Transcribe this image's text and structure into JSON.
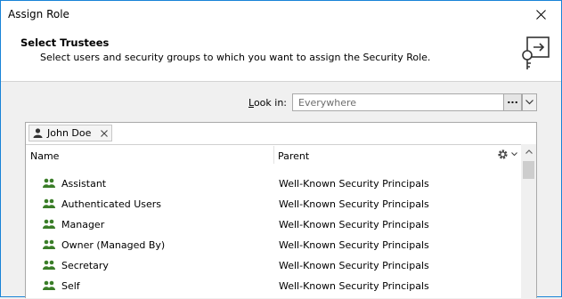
{
  "window": {
    "title": "Assign Role"
  },
  "header": {
    "title": "Select Trustees",
    "subtitle": "Select users and security groups to which you want to assign the Security Role."
  },
  "lookin": {
    "label_access": "L",
    "label_rest": "ook in:",
    "value": "Everywhere",
    "browse_label": "..."
  },
  "selected": [
    {
      "label": "John Doe"
    }
  ],
  "columns": {
    "name": "Name",
    "parent": "Parent"
  },
  "rows": [
    {
      "name": "Assistant",
      "parent": "Well-Known Security Principals"
    },
    {
      "name": "Authenticated Users",
      "parent": "Well-Known Security Principals"
    },
    {
      "name": "Manager",
      "parent": "Well-Known Security Principals"
    },
    {
      "name": "Owner (Managed By)",
      "parent": "Well-Known Security Principals"
    },
    {
      "name": "Secretary",
      "parent": "Well-Known Security Principals"
    },
    {
      "name": "Self",
      "parent": "Well-Known Security Principals"
    }
  ],
  "colors": {
    "accent": "#1883d7",
    "group_icon": "#3a7d28"
  },
  "icons": {
    "header": "key-door-icon",
    "chip": "user-icon",
    "row": "group-icon",
    "columns": "gear-icon"
  }
}
